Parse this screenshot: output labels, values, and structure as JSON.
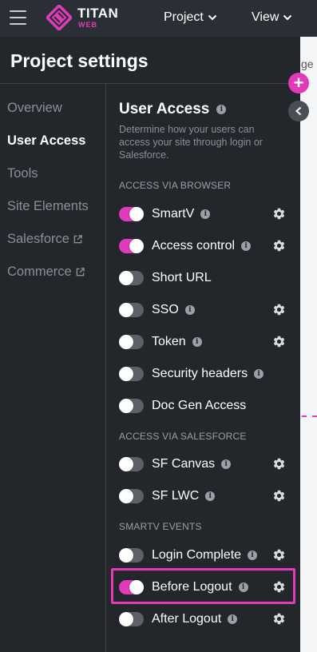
{
  "header": {
    "brand": "TITAN",
    "brand_sub": "WEB",
    "nav": [
      {
        "label": "Project"
      },
      {
        "label": "View"
      }
    ]
  },
  "right_strip": {
    "text": "ge"
  },
  "panel": {
    "title": "Project settings",
    "nav": [
      {
        "label": "Overview",
        "active": false,
        "external": false
      },
      {
        "label": "User Access",
        "active": true,
        "external": false
      },
      {
        "label": "Tools",
        "active": false,
        "external": false
      },
      {
        "label": "Site Elements",
        "active": false,
        "external": false
      },
      {
        "label": "Salesforce",
        "active": false,
        "external": true
      },
      {
        "label": "Commerce",
        "active": false,
        "external": true
      }
    ],
    "section": {
      "title": "User Access",
      "description": "Determine how your users can access your site through login or Salesforce."
    },
    "groups": [
      {
        "heading": "ACCESS VIA BROWSER",
        "items": [
          {
            "label": "SmartV",
            "on": true,
            "info": true,
            "settings": true
          },
          {
            "label": "Access control",
            "on": true,
            "info": true,
            "settings": true
          },
          {
            "label": "Short URL",
            "on": false,
            "info": false,
            "settings": false
          },
          {
            "label": "SSO",
            "on": false,
            "info": true,
            "settings": true
          },
          {
            "label": "Token",
            "on": false,
            "info": true,
            "settings": true
          },
          {
            "label": "Security headers",
            "on": false,
            "info": true,
            "settings": false
          },
          {
            "label": "Doc Gen Access",
            "on": false,
            "info": false,
            "settings": false
          }
        ]
      },
      {
        "heading": "ACCESS VIA SALESFORCE",
        "items": [
          {
            "label": "SF Canvas",
            "on": false,
            "info": true,
            "settings": true
          },
          {
            "label": "SF LWC",
            "on": false,
            "info": true,
            "settings": true
          }
        ]
      },
      {
        "heading": "SMARTV EVENTS",
        "items": [
          {
            "label": "Login Complete",
            "on": false,
            "info": true,
            "settings": true
          },
          {
            "label": "Before Logout",
            "on": true,
            "info": true,
            "settings": true
          },
          {
            "label": "After Logout",
            "on": false,
            "info": true,
            "settings": true
          }
        ]
      }
    ],
    "info_glyph": "i",
    "plus_glyph": "+"
  },
  "colors": {
    "accent": "#e23ab9",
    "background": "#23272c",
    "topbar": "#2a2f35",
    "muted_text": "#8b9097",
    "toggle_off": "#5c6168"
  },
  "icons": [
    "hamburger-icon",
    "titan-logo",
    "chevron-down-icon",
    "external-link-icon",
    "info-icon",
    "gear-icon",
    "plus-icon",
    "chevron-left-icon"
  ]
}
